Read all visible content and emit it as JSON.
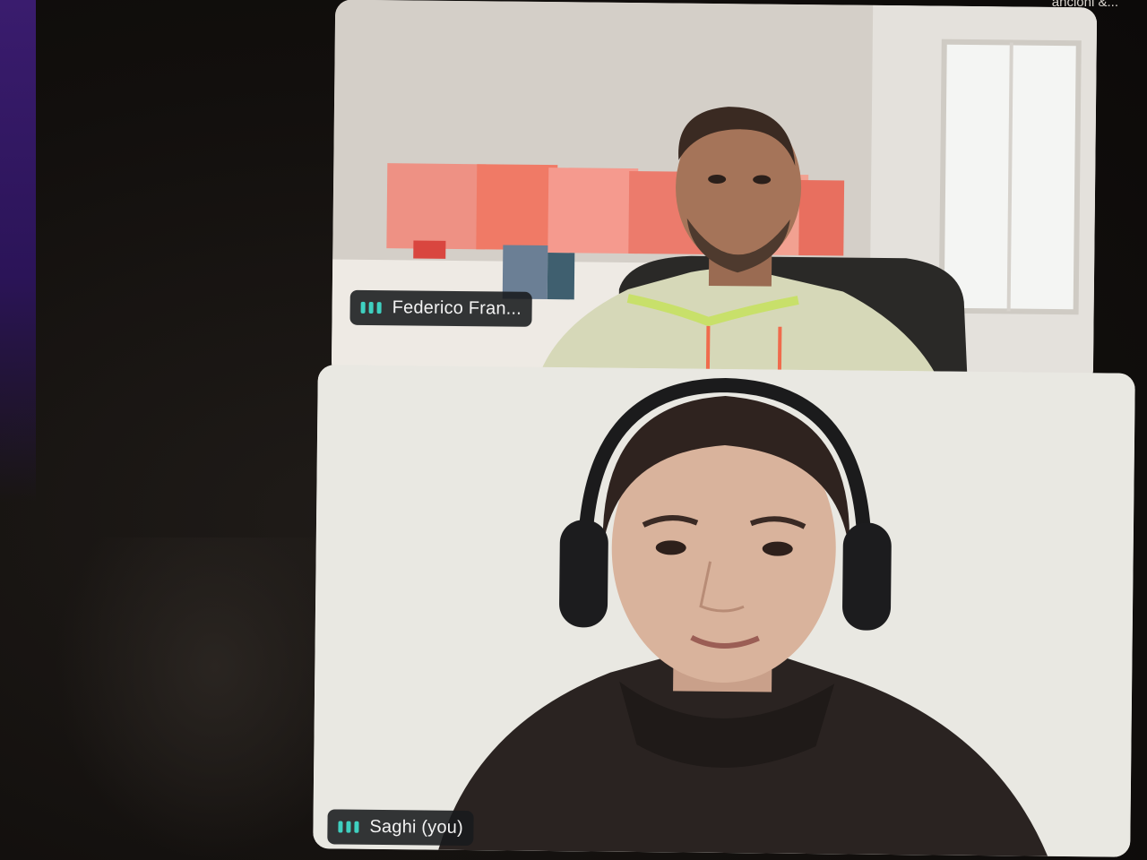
{
  "window": {
    "title_fragment": "ancioni &..."
  },
  "participants": [
    {
      "name": "Federico Fran...",
      "indicator": "audio-level-icon",
      "camera": "on"
    },
    {
      "name": "Saghi (you)",
      "indicator": "audio-level-icon",
      "camera": "on"
    }
  ],
  "colors": {
    "audio_indicator": "#3fd0c0",
    "name_tag_bg": "#181a1c",
    "background": "#14110f"
  }
}
